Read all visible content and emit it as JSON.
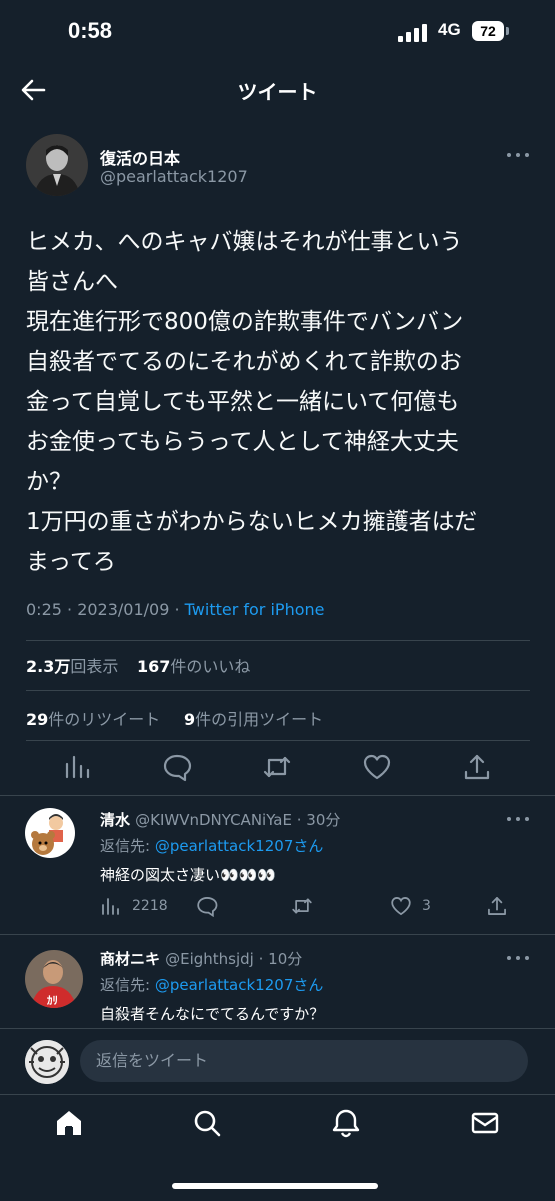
{
  "status_bar": {
    "time": "0:58",
    "network": "4G",
    "battery": "72"
  },
  "header": {
    "title": "ツイート"
  },
  "tweet": {
    "author_name": "復活の日本",
    "author_handle": "@pearlattack1207",
    "lines": [
      "ヒメカ、へのキャバ嬢はそれが仕事という",
      "皆さんへ",
      "現在進行形で800億の詐欺事件でバンバン",
      "自殺者でてるのにそれがめくれて詐欺のお",
      "金って自覚しても平然と一緒にいて何億も",
      "お金使ってもらうって人として神経大丈夫",
      "か？",
      "1万円の重さがわからないヒメカ擁護者はだ",
      "まってろ"
    ],
    "timestamp": "0:25 · 2023/01/09 · ",
    "source": "Twitter for iPhone",
    "views_count": "2.3万",
    "views_label": "回表示",
    "likes_count": "167",
    "likes_label": "件のいいね",
    "retweets_count": "29",
    "retweets_label": "件のリツイート",
    "quotes_count": "9",
    "quotes_label": "件の引用ツイート"
  },
  "replies": [
    {
      "name": "清水",
      "handle": "@KIWVnDNYCANiYaE · 30分",
      "reply_prefix": "返信先: ",
      "reply_to": "@pearlattack1207さん",
      "text": "神経の図太さ凄い👀👀👀",
      "views": "2218",
      "likes": "3"
    },
    {
      "name": "商材ニキ",
      "handle": "@Eighthsjdj · 10分",
      "reply_prefix": "返信先: ",
      "reply_to": "@pearlattack1207さん",
      "text": "自殺者そんなにでてるんですか？"
    }
  ],
  "compose": {
    "placeholder": "返信をツイート"
  },
  "icons": {
    "back": "arrow-left-icon",
    "more": "more-dots-icon",
    "views": "bar-chart-icon",
    "reply": "comment-icon",
    "retweet": "retweet-icon",
    "like": "heart-icon",
    "share": "share-icon",
    "home": "home-icon",
    "search": "search-icon",
    "notifications": "bell-icon",
    "messages": "envelope-icon"
  },
  "colors": {
    "background": "#15202b",
    "accent": "#1d9bf0",
    "muted": "#8b98a5"
  }
}
